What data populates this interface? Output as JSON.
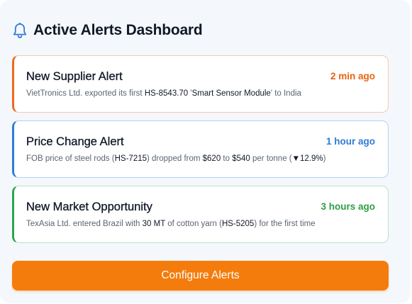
{
  "header": {
    "title": "Active Alerts Dashboard",
    "icon": "bell-icon"
  },
  "alerts": [
    {
      "title": "New Supplier Alert",
      "time": "2 min ago",
      "accent": "#ea6a1c",
      "desc": {
        "t1": "VietTronics Ltd. exported its first ",
        "b1": "HS-8543.70",
        "t2": " '",
        "b2": "Smart Sensor Module",
        "t3": "' to India"
      }
    },
    {
      "title": "Price Change Alert",
      "time": "1 hour ago",
      "accent": "#2f7bd6",
      "desc": {
        "t1": "FOB price of steel rods (",
        "b1": "HS-7215",
        "t2": ") dropped from ",
        "b2": "$620",
        "t3": " to ",
        "b3": "$540",
        "t4": " per tonne (",
        "b4": "▼12.9%",
        "t5": ")"
      }
    },
    {
      "title": "New Market Opportunity",
      "time": "3 hours ago",
      "accent": "#2ea44f",
      "desc": {
        "t1": "TexAsia Ltd. entered Brazil with ",
        "b1": "30 MT",
        "t2": " of cotton yarn (",
        "b2": "HS-5205",
        "t3": ") for the first time"
      }
    }
  ],
  "configure_button": {
    "label": "Configure Alerts",
    "color": "#f47c0c"
  }
}
